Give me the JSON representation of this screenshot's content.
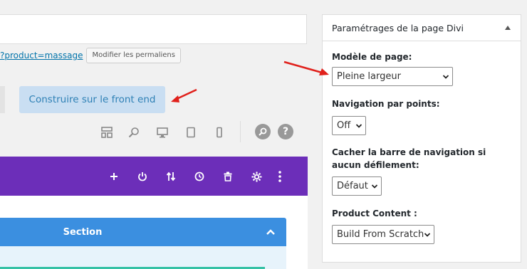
{
  "editor": {
    "permalink_text": "?product=massage",
    "permalink_button": "Modifier les permaliens",
    "frontend_button": "Construire sur le front end",
    "section_label": "Section"
  },
  "panel": {
    "title": "Paramétrages de la page Divi",
    "fields": [
      {
        "label": "Modèle de page:",
        "value": "Pleine largeur"
      },
      {
        "label": "Navigation par points:",
        "value": "Off"
      },
      {
        "label": "Cacher la barre de navigation si aucun défilement:",
        "value": "Défaut"
      },
      {
        "label": "Product Content :",
        "value": "Build From Scratch"
      }
    ]
  },
  "help_icon": "?",
  "colors": {
    "purple_bar": "#6c2eb9",
    "section_blue": "#3b8fe0",
    "frontend_button_bg": "#c9def2",
    "arrow_red": "#e0201b"
  }
}
